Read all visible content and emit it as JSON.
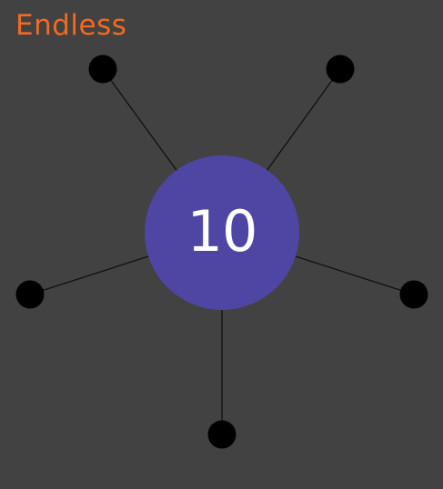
{
  "game": {
    "mode_label": "Endless",
    "pins_remaining": "10"
  },
  "pins": [
    {
      "name": "pin-upper-left"
    },
    {
      "name": "pin-upper-right"
    },
    {
      "name": "pin-left"
    },
    {
      "name": "pin-right"
    },
    {
      "name": "pin-bottom"
    }
  ],
  "colors": {
    "background": "#424242",
    "mode_label": "#f26a21",
    "hub": "#4f46a3",
    "hub_text": "#ffffff",
    "pin": "#000000",
    "pin_line": "#111111"
  }
}
